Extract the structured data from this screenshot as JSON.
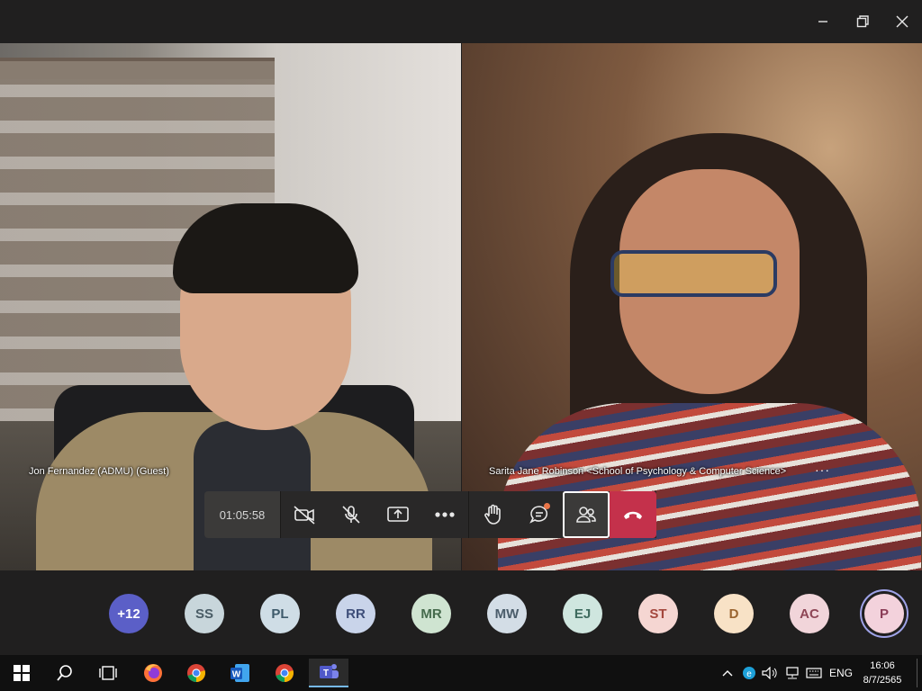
{
  "window": {
    "minimize_icon": "minimize-icon",
    "maximize_icon": "restore-icon",
    "close_icon": "close-icon"
  },
  "participants": [
    {
      "name": "Jon Fernandez (ADMU) (Guest)"
    },
    {
      "name": "Sarita Jane Robinson <School of Psychology & Computer Science>",
      "more": "···"
    }
  ],
  "call_controls": {
    "duration": "01:05:58",
    "buttons": [
      {
        "icon": "camera-off-icon"
      },
      {
        "icon": "mic-off-icon"
      },
      {
        "icon": "share-screen-icon"
      },
      {
        "icon": "more-icon"
      },
      {
        "icon": "raise-hand-icon"
      },
      {
        "icon": "chat-icon",
        "notification": true
      },
      {
        "icon": "participants-icon",
        "active": true
      },
      {
        "icon": "hang-up-icon"
      }
    ],
    "colors": {
      "hangup": "#c4314b",
      "notification": "#e97548"
    }
  },
  "avatars": [
    {
      "initials": "+12",
      "color": "#5b5fc7",
      "text_color": "#ffffff"
    },
    {
      "initials": "SS",
      "color": "#c8d6db",
      "text_color": "#4a5d66"
    },
    {
      "initials": "PL",
      "color": "#cfdde6",
      "text_color": "#3e5a6b"
    },
    {
      "initials": "RR",
      "color": "#c9d4ea",
      "text_color": "#3f4f7a"
    },
    {
      "initials": "MR",
      "color": "#cfe4d1",
      "text_color": "#466b4d"
    },
    {
      "initials": "MW",
      "color": "#d3dde6",
      "text_color": "#4b5d6b"
    },
    {
      "initials": "EJ",
      "color": "#cfe6df",
      "text_color": "#3e6b5e"
    },
    {
      "initials": "ST",
      "color": "#f5d6d2",
      "text_color": "#a4473d"
    },
    {
      "initials": "D",
      "color": "#f8e2c6",
      "text_color": "#9a6430"
    },
    {
      "initials": "AC",
      "color": "#f1d5da",
      "text_color": "#8e4656"
    },
    {
      "initials": "P",
      "color": "#f3d2dc",
      "text_color": "#8a3d57",
      "selected": true
    }
  ],
  "taskbar": {
    "apps": [
      {
        "icon": "windows-start-icon"
      },
      {
        "icon": "search-icon"
      },
      {
        "icon": "task-view-icon"
      },
      {
        "icon": "firefox-icon"
      },
      {
        "icon": "chrome-icon"
      },
      {
        "icon": "word-icon"
      },
      {
        "icon": "chrome-icon"
      },
      {
        "icon": "teams-icon",
        "active": true
      }
    ],
    "tray": {
      "language": "ENG",
      "time": "16:06",
      "date": "8/7/2565"
    }
  }
}
